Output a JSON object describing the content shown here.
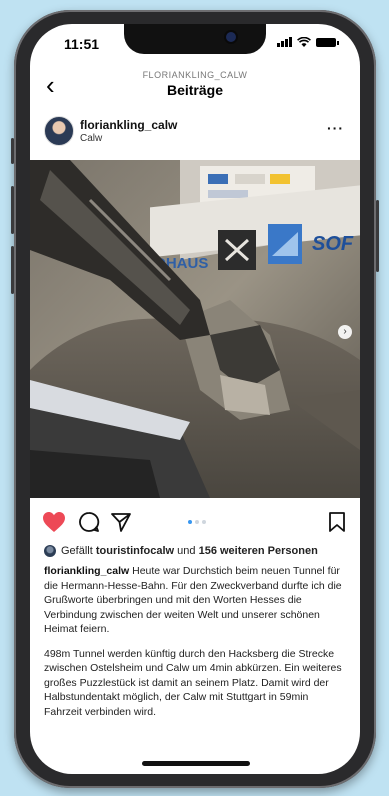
{
  "status": {
    "time": "11:51"
  },
  "nav": {
    "back_glyph": "‹",
    "subtitle": "FLORIANKLING_CALW",
    "title": "Beiträge"
  },
  "post": {
    "username": "floriankling_calw",
    "location": "Calw",
    "more_glyph": "···",
    "photo": {
      "banner_text_left": "DHAUS",
      "banner_text_right": "SOF",
      "carousel_next_glyph": "›"
    },
    "actions": {
      "liked": true,
      "icons": [
        "heart-icon",
        "comment-icon",
        "share-icon",
        "bookmark-icon"
      ],
      "carousel_dots": 3,
      "carousel_active": 0
    },
    "likes": {
      "prefix": "Gefällt",
      "user": "touristinfocalw",
      "joiner": "und",
      "others": "156 weiteren Personen"
    },
    "caption": {
      "author": "floriankling_calw",
      "paragraph1": "Heute war Durchstich beim neuen Tunnel für die Hermann-Hesse-Bahn. Für den Zweckverband durfte ich die Grußworte überbringen und mit den Worten Hesses die Verbindung zwischen der weiten Welt und unserer schönen Heimat feiern.",
      "paragraph2": "498m Tunnel werden künftig durch den Hacksberg die Strecke zwischen Ostelsheim und Calw um 4min abkürzen. Ein weiteres großes Puzzlestück ist damit an seinem Platz. Damit wird der Halbstundentakt möglich, der Calw mit Stuttgart in 59min Fahrzeit verbinden wird."
    }
  },
  "colors": {
    "background": "#bfe2f2",
    "like_red": "#ed4956",
    "dot_active": "#3897f0",
    "frame": "#2a2a2c"
  }
}
